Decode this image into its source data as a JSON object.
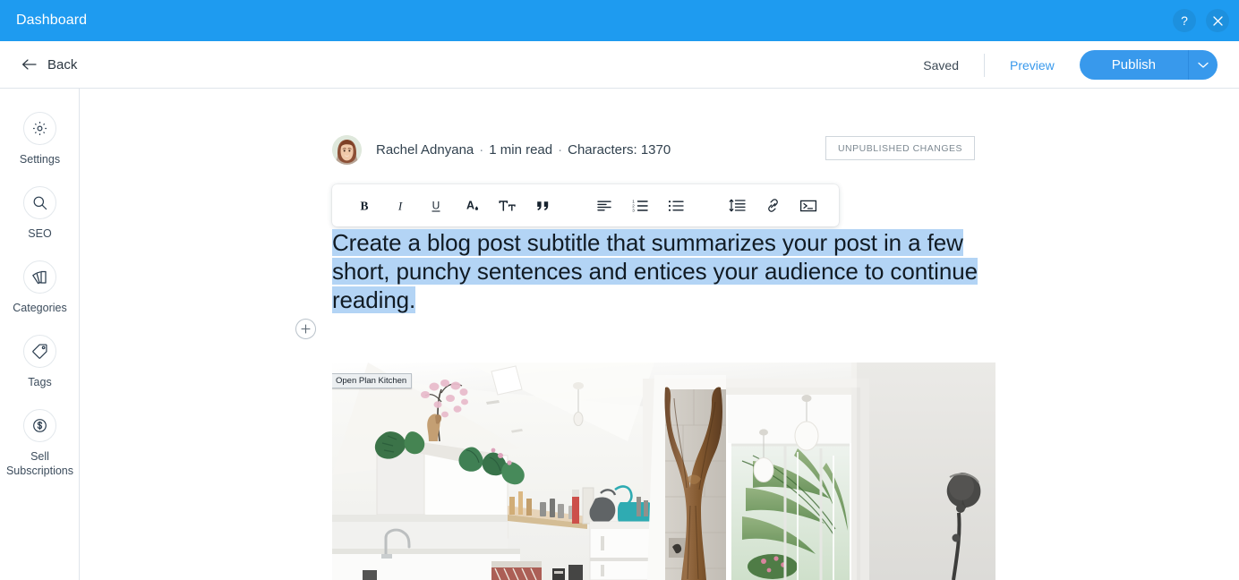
{
  "topbar": {
    "title": "Dashboard",
    "help_icon": "question-mark-icon",
    "close_icon": "close-icon",
    "background": "#1e9bf0"
  },
  "subheader": {
    "back_label": "Back",
    "saved_label": "Saved",
    "preview_label": "Preview",
    "publish_label": "Publish",
    "publish_color": "#3899ec",
    "preview_color": "#3899ec"
  },
  "sidebar": {
    "items": [
      {
        "label": "Settings",
        "icon": "gear-icon"
      },
      {
        "label": "SEO",
        "icon": "search-icon"
      },
      {
        "label": "Categories",
        "icon": "cards-stack-icon"
      },
      {
        "label": "Tags",
        "icon": "tag-icon"
      },
      {
        "label": "Sell Subscriptions",
        "icon": "dollar-circle-icon"
      }
    ]
  },
  "post": {
    "author": "Rachel Adnyana",
    "read_time": "1 min read",
    "characters": "Characters: 1370",
    "separator": "·",
    "status_badge": "UNPUBLISHED CHANGES",
    "title_text": "Create a blog post subtitle that summarizes your post in a few short, punchy sentences and entices your audience to continue reading.",
    "selection_color": "#b3d4f5",
    "add_block_icon": "plus-circle-icon",
    "image_label": "Open Plan Kitchen"
  },
  "format_toolbar": {
    "groups": [
      {
        "buttons": [
          {
            "name": "bold-button",
            "icon": "bold-icon",
            "label": "B"
          },
          {
            "name": "italic-button",
            "icon": "italic-icon",
            "label": "I"
          },
          {
            "name": "underline-button",
            "icon": "underline-icon",
            "label": "U"
          },
          {
            "name": "text-color-button",
            "icon": "text-color-icon",
            "label": "A"
          },
          {
            "name": "font-size-button",
            "icon": "font-size-icon",
            "label": "Tt"
          },
          {
            "name": "blockquote-button",
            "icon": "quote-icon",
            "label": "”"
          }
        ]
      },
      {
        "buttons": [
          {
            "name": "align-button",
            "icon": "align-left-icon",
            "label": ""
          },
          {
            "name": "ordered-list-button",
            "icon": "numbered-list-icon",
            "label": ""
          },
          {
            "name": "unordered-list-button",
            "icon": "bullet-list-icon",
            "label": ""
          }
        ]
      },
      {
        "buttons": [
          {
            "name": "line-spacing-button",
            "icon": "line-spacing-icon",
            "label": ""
          },
          {
            "name": "link-button",
            "icon": "link-icon",
            "label": ""
          },
          {
            "name": "embed-code-button",
            "icon": "code-terminal-icon",
            "label": ""
          }
        ]
      }
    ]
  }
}
